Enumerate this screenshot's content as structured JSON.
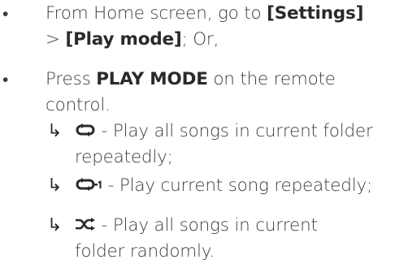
{
  "bullets": [
    {
      "part1": "From Home screen, go to ",
      "settings": "[Settings]",
      "sep": "> ",
      "playmode": "[Play mode]",
      "tail": "; Or,"
    },
    {
      "part1": "Press ",
      "key": "PLAY MODE",
      "part2": " on the remote",
      "line2": "control."
    }
  ],
  "modes": [
    {
      "icon": "repeat-all-icon",
      "text1": " - Play all songs in current folder",
      "text2": "repeatedly;"
    },
    {
      "icon": "repeat-one-icon",
      "text1": " - Play current song repeatedly;"
    },
    {
      "icon": "shuffle-icon",
      "text1": " - Play all songs in current",
      "text2": "folder randomly."
    }
  ],
  "symbols": {
    "bullet": "•",
    "arrow": "↳"
  },
  "colors": {
    "text": "#3c3c3c",
    "bold": "#2a2a2a"
  }
}
